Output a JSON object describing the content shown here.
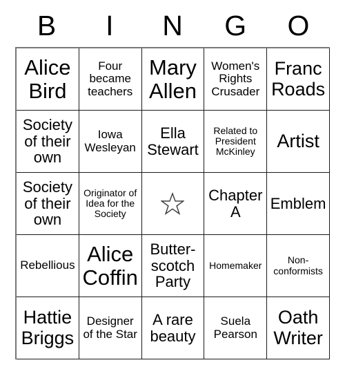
{
  "card": {
    "title": "BINGO Card",
    "header_letters": [
      "B",
      "I",
      "N",
      "G",
      "O"
    ],
    "free_space_icon": "star-icon",
    "colors": {
      "background": "#ffffff",
      "text": "#000000",
      "grid_line": "#1a1a1a",
      "outer_frame": "#777777",
      "star_outline": "#333333"
    },
    "rows": [
      [
        {
          "text": "Alice Bird",
          "size": "fs-xl"
        },
        {
          "text": "Four became teachers",
          "size": "fs-sm"
        },
        {
          "text": "Mary Allen",
          "size": "fs-xl"
        },
        {
          "text": "Women's Rights Crusader",
          "size": "fs-sm"
        },
        {
          "text": "Franc Roads",
          "size": "fs-lg"
        }
      ],
      [
        {
          "text": "Society of their own",
          "size": "fs-md"
        },
        {
          "text": "Iowa Wesleyan",
          "size": "fs-sm"
        },
        {
          "text": "Ella Stewart",
          "size": "fs-md"
        },
        {
          "text": "Related to President McKinley",
          "size": "fs-xs"
        },
        {
          "text": "Artist",
          "size": "fs-lg"
        }
      ],
      [
        {
          "text": "Society of their own",
          "size": "fs-md"
        },
        {
          "text": "Originator of Idea for the Society",
          "size": "fs-xs"
        },
        {
          "text": "",
          "size": "fs-md",
          "free": true
        },
        {
          "text": "Chapter A",
          "size": "fs-md"
        },
        {
          "text": "Emblem",
          "size": "fs-md"
        }
      ],
      [
        {
          "text": "Rebellious",
          "size": "fs-sm"
        },
        {
          "text": "Alice Coffin",
          "size": "fs-xl"
        },
        {
          "text": "Butter-scotch Party",
          "size": "fs-md"
        },
        {
          "text": "Homemaker",
          "size": "fs-xs"
        },
        {
          "text": "Non-conformists",
          "size": "fs-xs"
        }
      ],
      [
        {
          "text": "Hattie Briggs",
          "size": "fs-lg"
        },
        {
          "text": "Designer of the Star",
          "size": "fs-sm"
        },
        {
          "text": "A rare beauty",
          "size": "fs-md"
        },
        {
          "text": "Suela Pearson",
          "size": "fs-sm"
        },
        {
          "text": "Oath Writer",
          "size": "fs-lg"
        }
      ]
    ]
  }
}
